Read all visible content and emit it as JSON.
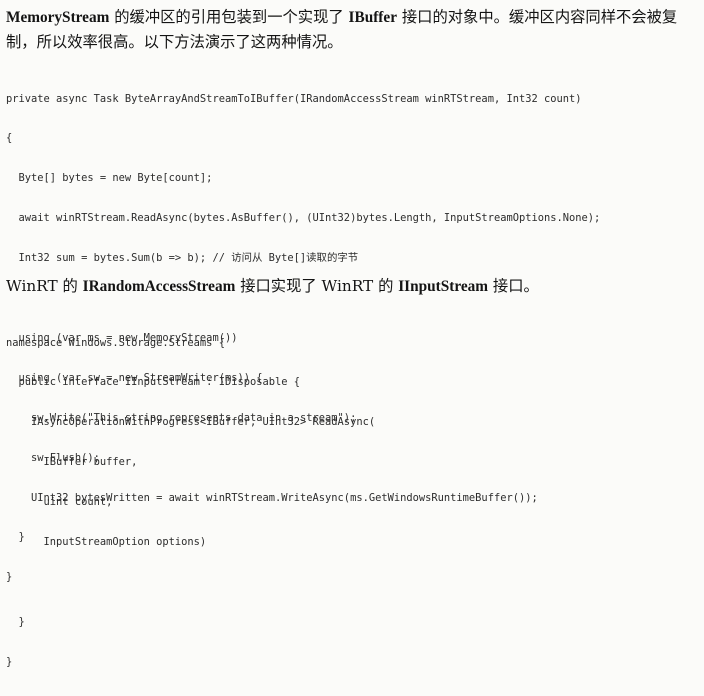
{
  "paragraph1": {
    "b1": "MemoryStream",
    "t1": " 的缓冲区的引用包装到一个实现了 ",
    "b2": "IBuffer",
    "t2": " 接口的对象中。缓冲区内容同样不会被复制，所以效率很高。以下方法演示了这两种情况。"
  },
  "code1": [
    "private async Task ByteArrayAndStreamToIBuffer(IRandomAccessStream winRTStream, Int32 count)",
    "{",
    "  Byte[] bytes = new Byte[count];",
    "  await winRTStream.ReadAsync(bytes.AsBuffer(), (UInt32)bytes.Length, InputStreamOptions.None);",
    "  Int32 sum = bytes.Sum(b => b); // 访问从 Byte[]读取的字节",
    "",
    "  using (var ms = new MemoryStream())",
    "  using (var sw = new StreamWriter(ms)) {",
    "    sw.Write(\"This string represents data in a stream\");",
    "    sw.Flush();",
    "    UInt32 bytesWritten = await winRTStream.WriteAsync(ms.GetWindowsRuntimeBuffer());",
    "  }",
    "}"
  ],
  "paragraph2": {
    "t1": "WinRT 的 ",
    "b1": "IRandomAccessStream",
    "t2": " 接口实现了 WinRT 的 ",
    "b2": "IInputStream",
    "t3": " 接口。"
  },
  "code2": [
    "namespace Windows.Storage.Streams {",
    "  public interface IInputStream : IDisposable {",
    "    IAsyncOperationWithProgress<IBuffer, UInt32> ReadAsync(",
    "      IBuffer buffer,",
    "      uint count,",
    "      InputStreamOption options)",
    "",
    "  }",
    "}"
  ]
}
